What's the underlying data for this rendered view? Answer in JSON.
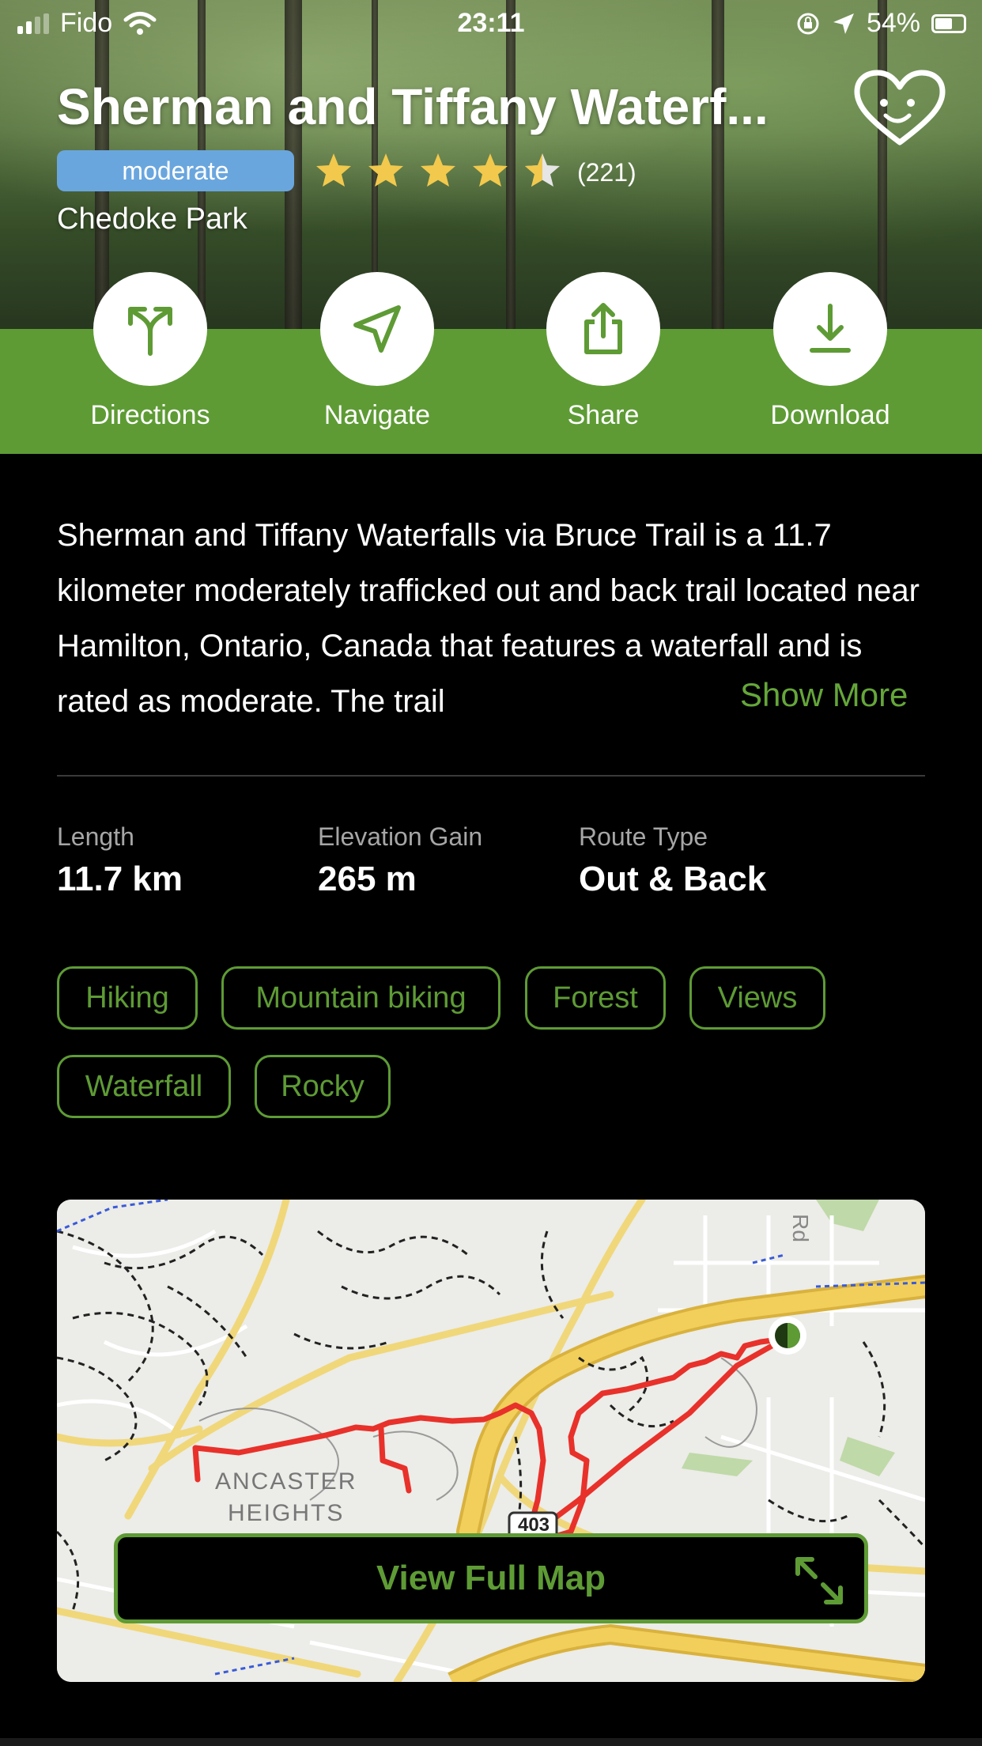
{
  "status_bar": {
    "carrier": "Fido",
    "time": "23:11",
    "battery": "54%"
  },
  "trail": {
    "title": "Sherman and Tiffany Waterf...",
    "difficulty": "moderate",
    "rating": 4.5,
    "rating_count": "(221)",
    "park": "Chedoke Park"
  },
  "actions": [
    {
      "label": "Directions",
      "icon": "directions-icon"
    },
    {
      "label": "Navigate",
      "icon": "navigate-icon"
    },
    {
      "label": "Share",
      "icon": "share-icon"
    },
    {
      "label": "Download",
      "icon": "download-icon"
    }
  ],
  "description": {
    "text": "Sherman and Tiffany Waterfalls via Bruce Trail  is a 11.7 kilometer moderately trafficked out and back trail located near Hamilton, Ontario, Canada that features a waterfall and is rated as moderate. The trail",
    "show_more": "Show More"
  },
  "stats": [
    {
      "label": "Length",
      "value": "11.7 km"
    },
    {
      "label": "Elevation Gain",
      "value": "265 m"
    },
    {
      "label": "Route Type",
      "value": "Out & Back"
    }
  ],
  "tags": [
    "Hiking",
    "Mountain biking",
    "Forest",
    "Views",
    "Waterfall",
    "Rocky"
  ],
  "map": {
    "place_label_1": "ANCASTER",
    "place_label_2": "HEIGHTS",
    "highway_shield": "403",
    "road_label": "Rd",
    "view_full_map": "View Full Map"
  },
  "colors": {
    "brand_green": "#5e9b35",
    "difficulty_blue": "#6aa6de",
    "star_yellow": "#f2c94c",
    "route_red": "#e8312a"
  }
}
